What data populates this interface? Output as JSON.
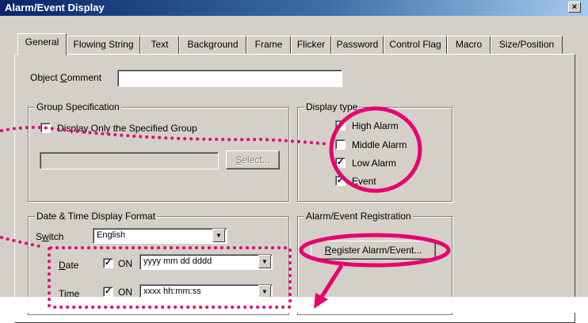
{
  "window": {
    "title": "Alarm/Event Display",
    "close_glyph": "×"
  },
  "tabs": [
    "General",
    "Flowing String",
    "Text",
    "Background",
    "Frame",
    "Flicker",
    "Password",
    "Control Flag",
    "Macro",
    "Size/Position"
  ],
  "active_tab": "General",
  "object_comment": {
    "label": "Object Comment",
    "value": ""
  },
  "group_spec": {
    "legend": "Group Specification",
    "checkbox_label": "Display Only the Specified Group",
    "checked": false,
    "group_value": "",
    "select_button": "Select..."
  },
  "display_type": {
    "legend": "Display type",
    "items": [
      {
        "label": "High Alarm",
        "checked": true
      },
      {
        "label": "Middle Alarm",
        "checked": false
      },
      {
        "label": "Low Alarm",
        "checked": true
      },
      {
        "label": "Event",
        "checked": true
      }
    ]
  },
  "datetime": {
    "legend": "Date & Time Display Format",
    "switch_label": "Switch",
    "switch_value": "English",
    "date_label": "Date",
    "date_on_label": "ON",
    "date_on_checked": true,
    "date_format": "yyyy mm dd  dddd",
    "time_label": "Time",
    "time_on_label": "ON",
    "time_on_checked": true,
    "time_format": "xxxx hh:mm:ss"
  },
  "registration": {
    "legend": "Alarm/Event Registration",
    "button": "Register Alarm/Event..."
  },
  "annotation_color": "#e8006f",
  "dialog_bg": "#d4d0c8"
}
